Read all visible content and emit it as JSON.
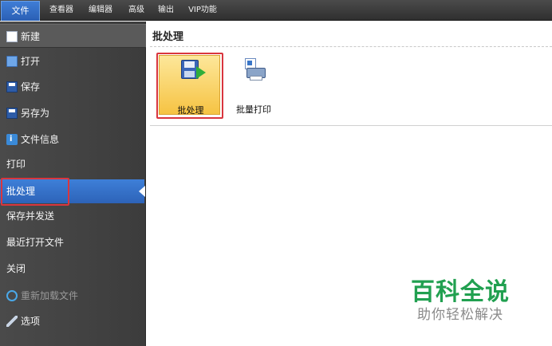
{
  "menubar": {
    "items": [
      {
        "label": "文件",
        "active": true
      },
      {
        "label": "查看器",
        "active": false
      },
      {
        "label": "编辑器",
        "active": false
      },
      {
        "label": "高级",
        "active": false
      },
      {
        "label": "输出",
        "active": false
      },
      {
        "label": "VIP功能",
        "active": false
      }
    ]
  },
  "sidebar": {
    "items": [
      {
        "label": "新建",
        "icon": "new-document-icon"
      },
      {
        "label": "打开",
        "icon": "folder-open-icon"
      },
      {
        "label": "保存",
        "icon": "save-icon"
      },
      {
        "label": "另存为",
        "icon": "save-as-icon"
      },
      {
        "label": "文件信息",
        "icon": "file-info-icon"
      },
      {
        "label": "打印"
      },
      {
        "label": "批处理",
        "selected": true
      },
      {
        "label": "保存并发送"
      },
      {
        "label": "最近打开文件"
      },
      {
        "label": "关闭"
      },
      {
        "label": "重新加载文件",
        "icon": "reload-icon",
        "disabled": true
      },
      {
        "label": "选项",
        "icon": "options-tool-icon"
      }
    ]
  },
  "main": {
    "title": "批处理",
    "tiles": [
      {
        "label": "批处理",
        "icon": "batch-process-icon",
        "highlighted": true
      },
      {
        "label": "批量打印",
        "icon": "batch-print-icon"
      }
    ]
  },
  "watermark": {
    "title": "百科全说",
    "subtitle": "助你轻松解决"
  },
  "colors": {
    "accent": "#2d63b8",
    "highlight_frame": "#d9363e",
    "tile_fill": "#f6c343",
    "watermark": "#21a050"
  }
}
